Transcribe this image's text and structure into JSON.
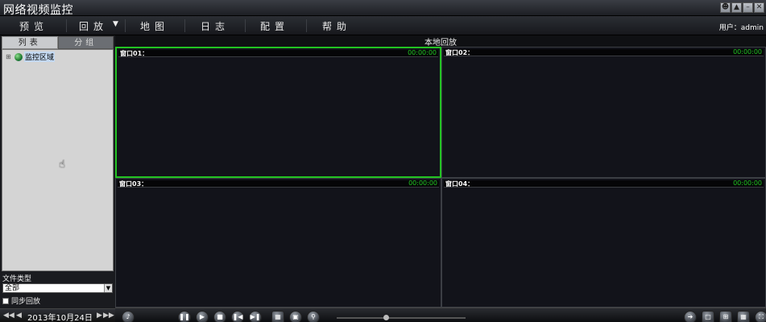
{
  "window": {
    "title": "网络视频监控",
    "buttons": [
      "user-icon",
      "pin-icon",
      "minimize-icon",
      "close-icon"
    ]
  },
  "menu": {
    "items": [
      {
        "label": "预览"
      },
      {
        "label": "回放"
      },
      {
        "label": "地图"
      },
      {
        "label": "日志"
      },
      {
        "label": "配置"
      },
      {
        "label": "帮助"
      }
    ],
    "user": "用户：admin"
  },
  "left_panel": {
    "tabs": [
      {
        "label": "列表"
      },
      {
        "label": "分组"
      }
    ],
    "tree_root": "监控区域",
    "file_type_label": "文件类型",
    "file_type_value": "全部",
    "sync_label": "同步回放",
    "sync_checked": false,
    "date": "2013年10月24日"
  },
  "main": {
    "title": "本地回放",
    "windows": [
      {
        "name": "窗口01：",
        "time": "00:00:00",
        "selected": true
      },
      {
        "name": "窗口02：",
        "time": "00:00:00",
        "selected": false
      },
      {
        "name": "窗口03：",
        "time": "00:00:00",
        "selected": false
      },
      {
        "name": "窗口04：",
        "time": "00:00:00",
        "selected": false
      }
    ]
  },
  "colors": {
    "selected_border": "#22c322",
    "time_text": "#21c321",
    "background": "#12131a"
  }
}
